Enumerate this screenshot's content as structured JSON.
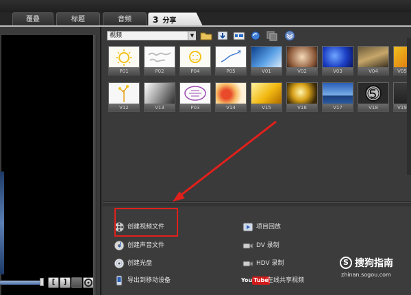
{
  "tabs": [
    {
      "label": "覆叠"
    },
    {
      "label": "标题"
    },
    {
      "label": "音频"
    },
    {
      "number": "3",
      "label": "分享",
      "active": true
    }
  ],
  "library": {
    "dropdown_value": "视频",
    "toolbar_icons": [
      "folder-open-icon",
      "import-icon",
      "batch-convert-icon",
      "refresh-icon",
      "duplicate-icon",
      "expand-down-icon"
    ],
    "thumbnails_row1": [
      "P01",
      "P02",
      "P04",
      "P05",
      "V01",
      "V02",
      "V03",
      "V04",
      "V05"
    ],
    "thumbnails_row2": [
      "V12",
      "V13",
      "P03",
      "V14",
      "V15",
      "V16",
      "V17",
      "V18",
      "V19"
    ]
  },
  "share_options": {
    "left": [
      {
        "icon": "film-reel-icon",
        "label": "创建视频文件"
      },
      {
        "icon": "audio-disc-icon",
        "label": "创建声音文件"
      },
      {
        "icon": "disc-icon",
        "label": "创建光盘"
      },
      {
        "icon": "mobile-device-icon",
        "label": "导出到移动设备"
      }
    ],
    "right": [
      {
        "icon": "project-playback-icon",
        "label": "项目回放"
      },
      {
        "icon": "dv-camera-icon",
        "label": "DV 录制"
      },
      {
        "icon": "hdv-camera-icon",
        "label": "HDV 录制"
      },
      {
        "icon": "youtube-logo-icon",
        "label": "在线共享视频",
        "logo_text": "YouTube"
      }
    ]
  },
  "preview_controls": [
    "[",
    "]"
  ],
  "watermark": {
    "logo_char": "S",
    "text": "搜狗指南",
    "url": "zhinan.sogou.com"
  },
  "colors": {
    "highlight": "#e0201c",
    "arrow": "#e0201c",
    "panel_bg": "#3a3a3a"
  }
}
